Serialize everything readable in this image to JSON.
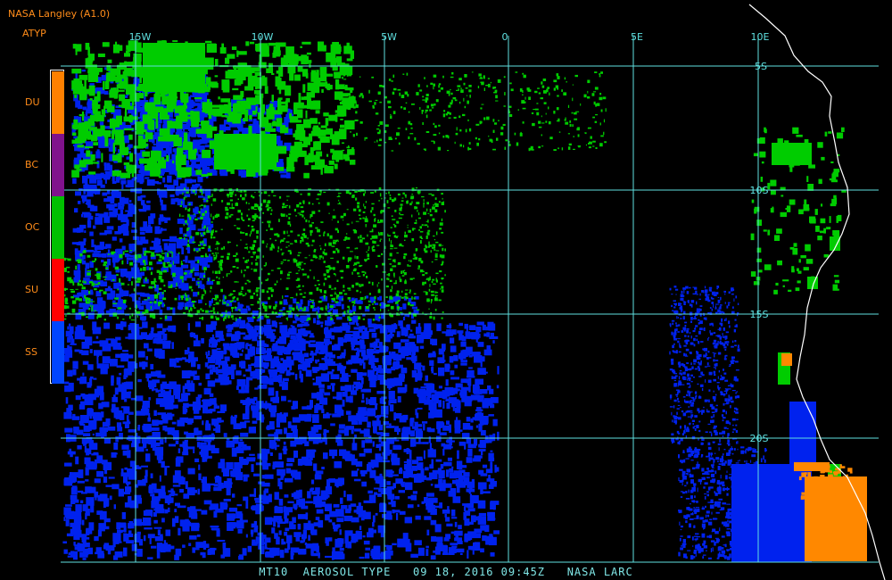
{
  "header": {
    "title": "NASA Langley (A1.0)",
    "product": "ATYP"
  },
  "legend": [
    {
      "code": "DU",
      "color": "#ff8000"
    },
    {
      "code": "BC",
      "color": "#80128c"
    },
    {
      "code": "OC",
      "color": "#00c000"
    },
    {
      "code": "SU",
      "color": "#ff0000"
    },
    {
      "code": "SS",
      "color": "#0044ff"
    }
  ],
  "map": {
    "lon_labels": [
      "15W",
      "10W",
      "5W",
      "0",
      "5E",
      "10E"
    ],
    "lat_labels": [
      "5S",
      "10S",
      "15S",
      "20S"
    ],
    "grid_color": "#5fe0e0",
    "coast_color": "#ffffff",
    "aerosol_colors": {
      "sea_salt": "#0022ee",
      "organic_carbon": "#00cc00",
      "dust": "#ff8800"
    }
  },
  "footer": {
    "caption": "MT10  AEROSOL TYPE   09 18, 2016 09:45Z   NASA LARC"
  }
}
